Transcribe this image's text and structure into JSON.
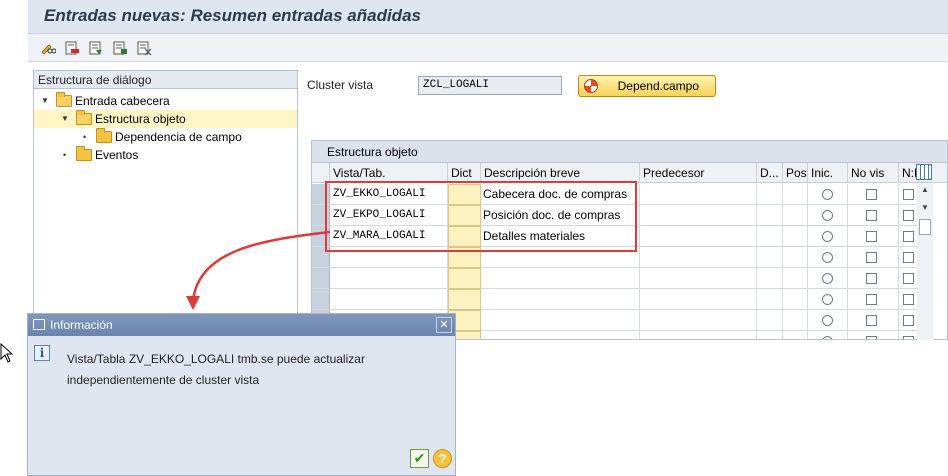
{
  "window": {
    "title": "Entradas nuevas: Resumen entradas añadidas"
  },
  "toolbar": {
    "icons": [
      "pencil-glasses-icon",
      "delete-entry-icon",
      "select-all-icon",
      "select-block-icon",
      "deselect-all-icon"
    ]
  },
  "dialog_structure": {
    "header": "Estructura de diálogo",
    "items": [
      {
        "label": "Entrada cabecera",
        "level": 0,
        "expanded": true,
        "selected": false
      },
      {
        "label": "Estructura objeto",
        "level": 1,
        "expanded": true,
        "selected": true
      },
      {
        "label": "Dependencia de campo",
        "level": 2,
        "expanded": false,
        "selected": false
      },
      {
        "label": "Eventos",
        "level": 0,
        "expanded": false,
        "selected": false
      }
    ]
  },
  "cluster": {
    "label": "Cluster vista",
    "value": "ZCL_LOGALI",
    "button_label": "Depend.campo"
  },
  "grid": {
    "title": "Estructura objeto",
    "columns": [
      "Vista/Tab.",
      "Dict",
      "Descripción breve",
      "Predecesor",
      "D...",
      "Pos",
      "Inic.",
      "No vis",
      "N:M"
    ],
    "rows": [
      {
        "vista": "ZV_EKKO_LOGALI",
        "desc": "Cabecera doc. de compras"
      },
      {
        "vista": "ZV_EKPO_LOGALI",
        "desc": "Posición doc. de compras"
      },
      {
        "vista": "ZV_MARA_LOGALI",
        "desc": "Detalles materiales"
      },
      {
        "vista": "",
        "desc": ""
      },
      {
        "vista": "",
        "desc": ""
      },
      {
        "vista": "",
        "desc": ""
      },
      {
        "vista": "",
        "desc": ""
      },
      {
        "vista": "",
        "desc": ""
      }
    ]
  },
  "popup": {
    "title": "Información",
    "line1": "Vista/Tabla ZV_EKKO_LOGALI tmb.se puede actualizar",
    "line2": "independientemente de cluster vista",
    "ok_icon": "checkmark-icon",
    "help_icon": "help-icon"
  },
  "colors": {
    "highlight": "#e03b3b",
    "popup_title": "#6a84ae",
    "button": "#f6d35a"
  }
}
